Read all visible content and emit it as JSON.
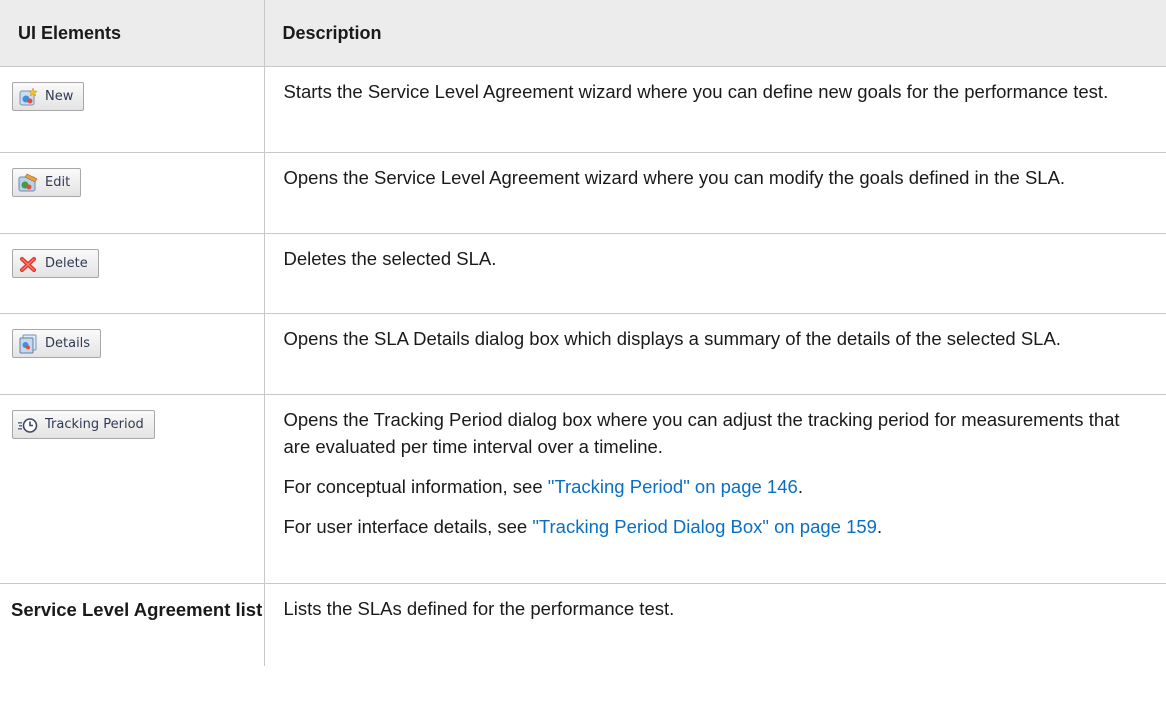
{
  "header": {
    "col1": "UI Elements",
    "col2": "Description"
  },
  "rows": [
    {
      "button": {
        "label": "New",
        "icon": "new-wizard-icon"
      },
      "description": "Starts the Service Level Agreement wizard where you can define new goals for the performance test."
    },
    {
      "button": {
        "label": "Edit",
        "icon": "edit-icon"
      },
      "description": "Opens the Service Level Agreement wizard where you can modify the goals defined in the SLA."
    },
    {
      "button": {
        "label": "Delete",
        "icon": "delete-x-icon"
      },
      "description": "Deletes the selected SLA."
    },
    {
      "button": {
        "label": "Details",
        "icon": "details-icon"
      },
      "description": "Opens the SLA Details dialog box which displays a summary of the details of the selected SLA."
    },
    {
      "button": {
        "label": "Tracking Period",
        "icon": "clock-icon"
      },
      "description": "Opens the Tracking Period dialog box where you can adjust the tracking period for measurements that are evaluated per time interval over a timeline.",
      "note1": {
        "prefix": "For conceptual information, see ",
        "link": "\"Tracking Period\" on page 146",
        "suffix": "."
      },
      "note2": {
        "prefix": "For user interface details, see ",
        "link": "\"Tracking Period Dialog Box\" on page 159",
        "suffix": "."
      }
    },
    {
      "label": "Service Level Agreement list",
      "description": "Lists the SLAs defined for the performance test."
    }
  ],
  "colors": {
    "link": "#0a6fc2",
    "header_bg": "#ececec",
    "border": "#c8c8c8",
    "delete_icon": "#e0302a"
  }
}
